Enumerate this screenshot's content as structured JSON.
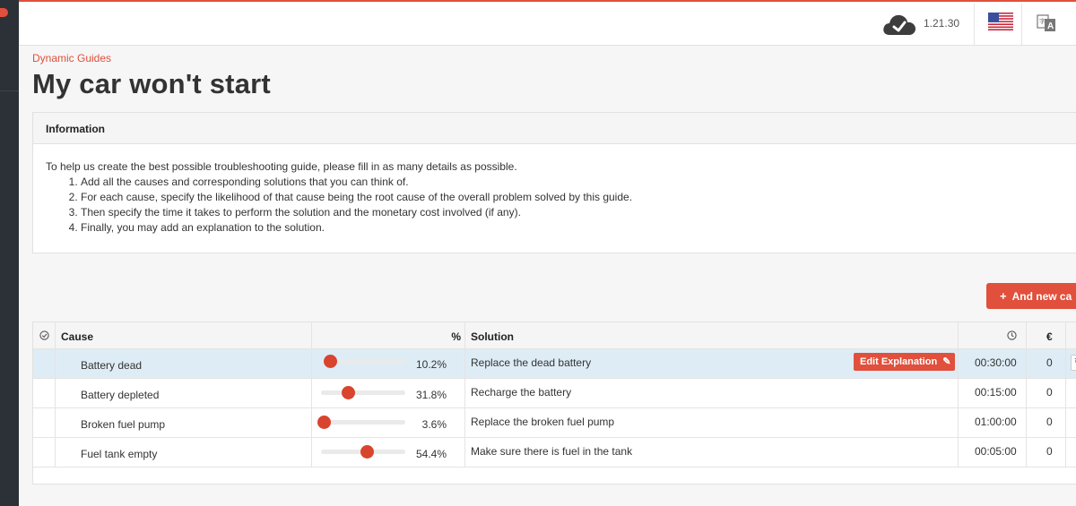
{
  "header": {
    "version": "1.21.30",
    "icons": [
      "cloud-check-icon",
      "us-flag-icon",
      "translate-icon"
    ]
  },
  "breadcrumb": "Dynamic Guides",
  "title": "My car won't start",
  "information": {
    "heading": "Information",
    "intro": "To help us create the best possible troubleshooting guide, please fill in as many details as possible.",
    "steps": [
      "Add all the causes and corresponding solutions that you can think of.",
      "For each cause, specify the likelihood of that cause being the root cause of the overall problem solved by this guide.",
      "Then specify the time it takes to perform the solution and the monetary cost involved (if any).",
      "Finally, you may add an explanation to the solution."
    ]
  },
  "add_button_label": "And new ca",
  "table": {
    "headers": {
      "cause": "Cause",
      "percent": "%",
      "solution": "Solution",
      "currency": "€"
    },
    "edit_label": "Edit Explanation",
    "rows": [
      {
        "cause": "Battery dead",
        "percent": "10.2%",
        "likelihood": 0.102,
        "solution": "Replace the dead battery",
        "time": "00:30:00",
        "cost": "0",
        "selected": true
      },
      {
        "cause": "Battery depleted",
        "percent": "31.8%",
        "likelihood": 0.318,
        "solution": "Recharge the battery",
        "time": "00:15:00",
        "cost": "0",
        "selected": false
      },
      {
        "cause": "Broken fuel pump",
        "percent": "3.6%",
        "likelihood": 0.036,
        "solution": "Replace the broken fuel pump",
        "time": "01:00:00",
        "cost": "0",
        "selected": false
      },
      {
        "cause": "Fuel tank empty",
        "percent": "54.4%",
        "likelihood": 0.544,
        "solution": "Make sure there is fuel in the tank",
        "time": "00:05:00",
        "cost": "0",
        "selected": false
      }
    ]
  },
  "colors": {
    "accent": "#e0503c",
    "sidebar": "#2b3136",
    "selected_row": "#deecf5"
  }
}
